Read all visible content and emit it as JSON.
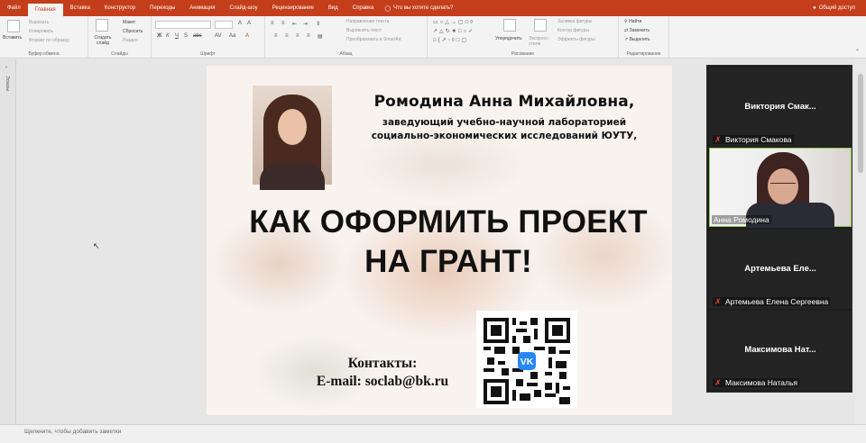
{
  "ribbon_tabs": [
    {
      "label": "Файл"
    },
    {
      "label": "Главная"
    },
    {
      "label": "Вставка"
    },
    {
      "label": "Конструктор"
    },
    {
      "label": "Переходы"
    },
    {
      "label": "Анимация"
    },
    {
      "label": "Слайд-шоу"
    },
    {
      "label": "Рецензирование"
    },
    {
      "label": "Вид"
    },
    {
      "label": "Справка"
    }
  ],
  "tell_me": "Что вы хотите сделать?",
  "share": "Общий доступ",
  "ribbon": {
    "clipboard": {
      "paste": "Вставить",
      "cut": "Вырезать",
      "copy": "Копировать",
      "format_painter": "Формат по образцу",
      "label": "Буфер обмена"
    },
    "slides": {
      "new_slide": "Создать слайд",
      "layout": "Макет",
      "reset": "Сбросить",
      "section": "Раздел",
      "label": "Слайды"
    },
    "font": {
      "label": "Шрифт"
    },
    "paragraph": {
      "text_direction": "Направление текста",
      "align_text": "Выровнять текст",
      "smartart": "Преобразовать в SmartArt",
      "label": "Абзац"
    },
    "drawing": {
      "arrange": "Упорядочить",
      "quick_styles": "Экспресс-стили",
      "shape_fill": "Заливка фигуры",
      "shape_outline": "Контур фигуры",
      "shape_effects": "Эффекты фигуры",
      "label": "Рисование"
    },
    "editing": {
      "find": "Найти",
      "replace": "Заменить",
      "select": "Выделить",
      "label": "Редактирование"
    }
  },
  "thumbnails_label": "Эскизы",
  "slide": {
    "author_name": "Ромодина Анна Михайловна,",
    "author_role_line1": "заведующий учебно-научной лабораторией",
    "author_role_line2": "социально-экономических исследований ЮУТУ,",
    "headline_line1": "КАК ОФОРМИТЬ ПРОЕКТ",
    "headline_line2": "НА ГРАНТ!",
    "contacts_label": "Контакты:",
    "email_line": "E-mail: soclab@bk.ru",
    "qr_center_label": "VK"
  },
  "participants": [
    {
      "display": "Виктория  Смак...",
      "name": "Виктория Смакова",
      "muted": true,
      "video": false
    },
    {
      "display": "",
      "name": "Анна Ромодина",
      "muted": false,
      "video": true
    },
    {
      "display": "Артемьева  Еле...",
      "name": "Артемьева Елена Сергеевна",
      "muted": true,
      "video": false
    },
    {
      "display": "Максимова  Нат...",
      "name": "Максимова Наталья",
      "muted": true,
      "video": false
    }
  ],
  "notes_placeholder": "Щелкните, чтобы добавить заметки",
  "colors": {
    "accent": "#c43e1c",
    "active_speaker": "#8fc84a",
    "muted": "#e0433a"
  }
}
